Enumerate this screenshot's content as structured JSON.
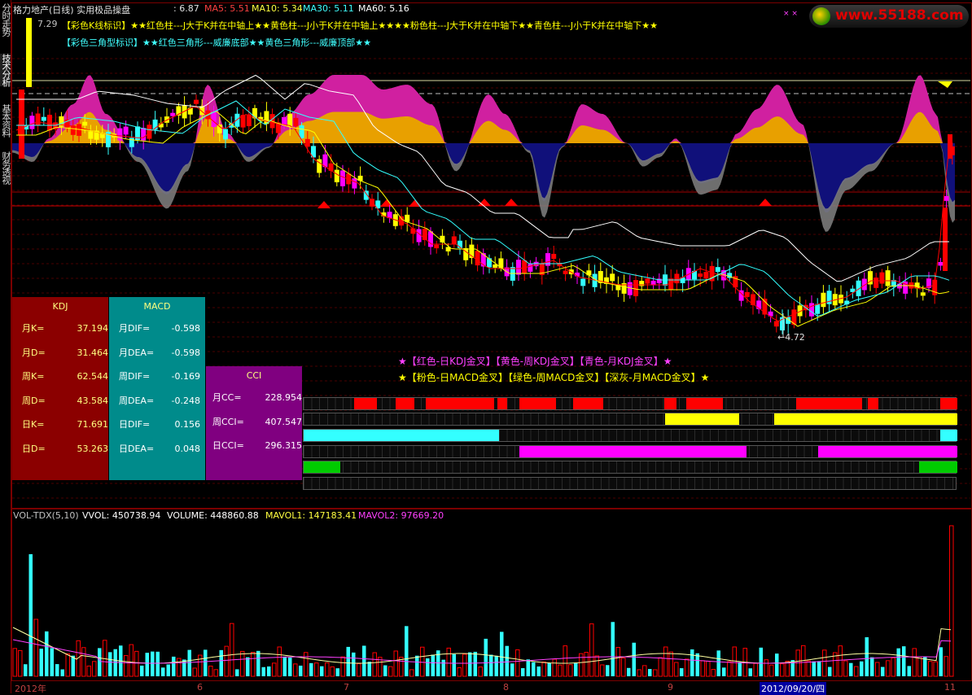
{
  "sidebar": {
    "tabs": [
      "分时走势",
      "技术分析",
      "基本资料",
      "财务透视"
    ]
  },
  "header": {
    "title": "格力地产(日线) 实用极品操盘",
    "price": ": 6.87",
    "ma5": "MA5: 5.51",
    "ma10": "MA10: 5.34",
    "ma30": "MA30: 5.11",
    "ma60": "MA60: 5.16",
    "line1_prefix": "7.29",
    "line1": "【彩色K线标识】★★红色柱---J大于K并在中轴上★★黄色柱---J小于K并在中轴上★★★★粉色柱---J大于K并在中轴下★★青色柱---J小于K并在中轴下★★",
    "line2": "【彩色三角型标识】★★红色三角形---威廉底部★★黄色三角形---威廉顶部★★",
    "watermark": "www.55188.com",
    "price_low": "←4.72"
  },
  "legend": {
    "kdj": "★【红色-日KDJ金叉】【黄色-周KDJ金叉】【青色-月KDJ金叉】★",
    "macd": "★【粉色-日MACD金叉】【绿色-周MACD金叉】【深灰-月MACD金叉】★"
  },
  "kdj": {
    "title": "KDJ",
    "rows": [
      [
        "月K=",
        "37.194"
      ],
      [
        "月D=",
        "31.464"
      ],
      [
        "周K=",
        "62.544"
      ],
      [
        "周D=",
        "43.584"
      ],
      [
        "日K=",
        "71.691"
      ],
      [
        "日D=",
        "53.263"
      ]
    ]
  },
  "macd": {
    "title": "MACD",
    "rows": [
      [
        "月DIF=",
        "-0.598"
      ],
      [
        "月DEA=",
        "-0.598"
      ],
      [
        "周DIF=",
        "-0.169"
      ],
      [
        "周DEA=",
        "-0.248"
      ],
      [
        "日DIF=",
        "0.156"
      ],
      [
        "日DEA=",
        "0.048"
      ]
    ]
  },
  "cci": {
    "title": "CCI",
    "rows": [
      [
        "月CC=",
        "228.954"
      ],
      [
        "周CCI=",
        "407.547"
      ],
      [
        "日CCI=",
        "296.315"
      ]
    ]
  },
  "volume": {
    "label": "VOL-TDX(5,10)",
    "vvol": "VVOL: 450738.94",
    "vol": "VOLUME: 448860.88",
    "mavol1": "MAVOL1: 147183.41",
    "mavol2": "MAVOL2: 97669.20"
  },
  "xaxis": {
    "labels": [
      "2012年",
      "6",
      "7",
      "8",
      "9",
      "2012/09/20/四",
      "11"
    ]
  },
  "colors": {
    "bg": "#000000",
    "red": "#ff0000",
    "cyan": "#33ffff",
    "yellow": "#ffff00",
    "magenta": "#ff00ff",
    "green": "#00cc00",
    "gray": "#808080",
    "navy": "#0a0a8a",
    "orange": "#e8a000",
    "kdj_bg": "#8b0000",
    "macd_bg": "#008b8b",
    "cci_bg": "#800080"
  }
}
